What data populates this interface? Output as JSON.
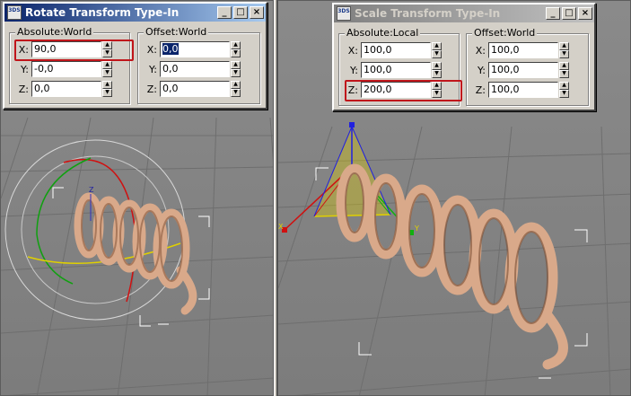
{
  "rotate_dialog": {
    "title": "Rotate Transform Type-In",
    "icon_text": "3DS",
    "absolute_label": "Absolute:World",
    "offset_label": "Offset:World",
    "absolute": {
      "x_label": "X:",
      "x_value": "90,0",
      "y_label": "Y:",
      "y_value": "-0,0",
      "z_label": "Z:",
      "z_value": "0,0"
    },
    "offset": {
      "x_label": "X:",
      "x_value": "0,0",
      "y_label": "Y:",
      "y_value": "0,0",
      "z_label": "Z:",
      "z_value": "0,0"
    }
  },
  "scale_dialog": {
    "title": "Scale Transform Type-In",
    "icon_text": "3DS",
    "absolute_label": "Absolute:Local",
    "offset_label": "Offset:World",
    "absolute": {
      "x_label": "X:",
      "x_value": "100,0",
      "y_label": "Y:",
      "y_value": "100,0",
      "z_label": "Z:",
      "z_value": "200,0"
    },
    "offset": {
      "x_label": "X:",
      "x_value": "100,0",
      "y_label": "Y:",
      "y_value": "100,0",
      "z_label": "Z:",
      "z_value": "100,0"
    }
  },
  "window_buttons": {
    "minimize": "_",
    "maximize": "□",
    "close": "×"
  },
  "gizmo_labels": {
    "z": "Z",
    "x": "X",
    "y": "Y"
  },
  "colors": {
    "highlight": "#c0151b",
    "title_active": "#0a246a",
    "spring": "#d9a98a"
  }
}
